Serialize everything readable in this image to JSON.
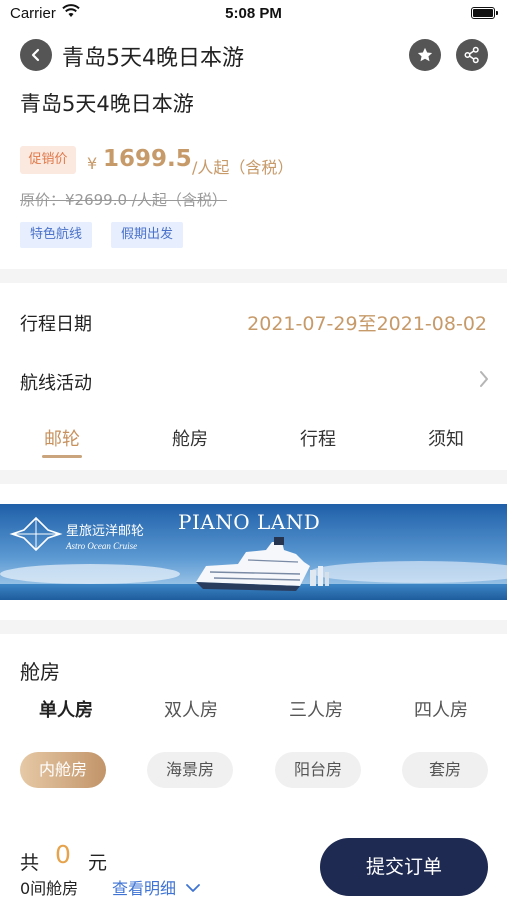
{
  "status_bar": {
    "carrier": "Carrier",
    "time": "5:08 PM"
  },
  "nav": {
    "title": "青岛5天4晚日本游",
    "back_icon": "chevron-left-icon",
    "favorite_icon": "star-icon",
    "share_icon": "share-icon"
  },
  "product": {
    "title": "青岛5天4晚日本游",
    "promo_label": "促销价",
    "currency": "¥",
    "price": "1699.5",
    "price_unit": "/人起（含税）",
    "original_price": "原价：¥2699.0 /人起（含税）",
    "tags": [
      "特色航线",
      "假期出发"
    ]
  },
  "itinerary": {
    "date_label": "行程日期",
    "dates": "2021-07-29至2021-08-02",
    "activity_label": "航线活动"
  },
  "tabs": [
    {
      "label": "邮轮",
      "active": true
    },
    {
      "label": "舱房",
      "active": false
    },
    {
      "label": "行程",
      "active": false
    },
    {
      "label": "须知",
      "active": false
    }
  ],
  "banner": {
    "logo_cn": "星旅远洋邮轮",
    "logo_en": "Astro Ocean Cruise",
    "ship_name": "PIANO LAND"
  },
  "cabins": {
    "title": "舱房",
    "room_tabs": [
      "单人房",
      "双人房",
      "三人房",
      "四人房"
    ],
    "types": [
      "内舱房",
      "海景房",
      "阳台房",
      "套房"
    ]
  },
  "footer": {
    "total_prefix": "共",
    "total_value": "0",
    "total_unit": "元",
    "room_count": "0间舱房",
    "detail_link": "查看明细",
    "submit_label": "提交订单"
  },
  "colors": {
    "accent_gold": "#c79a6a",
    "submit_navy": "#1e2a52",
    "link_blue": "#3f74d4"
  }
}
